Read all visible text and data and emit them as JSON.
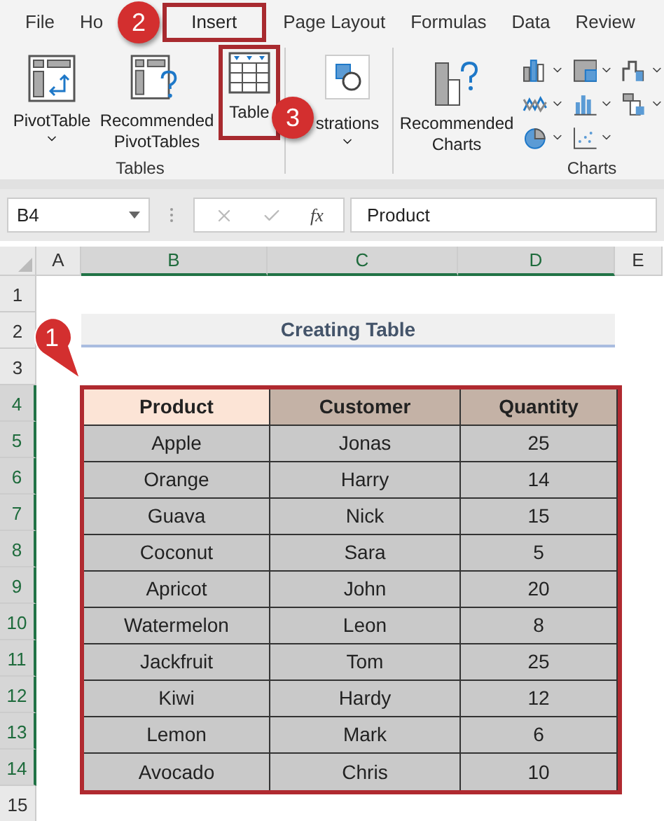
{
  "tabs": [
    {
      "label": "File",
      "selected": false
    },
    {
      "label": "Ho",
      "selected": false
    },
    {
      "label": "Insert",
      "selected": true
    },
    {
      "label": "Page Layout",
      "selected": false
    },
    {
      "label": "Formulas",
      "selected": false
    },
    {
      "label": "Data",
      "selected": false
    },
    {
      "label": "Review",
      "selected": false
    }
  ],
  "ribbon": {
    "groups": [
      {
        "label": "Tables",
        "buttons": [
          {
            "label": "PivotTable",
            "dropdown": true,
            "highlighted": false
          },
          {
            "label": "Recommended PivotTables",
            "dropdown": false,
            "highlighted": false
          },
          {
            "label": "Table",
            "dropdown": false,
            "highlighted": true
          }
        ]
      },
      {
        "buttons": [
          {
            "label": "strations",
            "dropdown": true,
            "highlighted": false
          }
        ]
      },
      {
        "label": "Charts",
        "buttons": [
          {
            "label": "Recommended Charts",
            "dropdown": false,
            "highlighted": false
          }
        ]
      }
    ]
  },
  "name_box": "B4",
  "formula_bar": {
    "function_label": "fx",
    "value": "Product"
  },
  "columns": [
    {
      "label": "A",
      "selected": false
    },
    {
      "label": "B",
      "selected": true
    },
    {
      "label": "C",
      "selected": true
    },
    {
      "label": "D",
      "selected": true
    },
    {
      "label": "E",
      "selected": false
    }
  ],
  "rows": [
    {
      "label": "1",
      "selected": false
    },
    {
      "label": "2",
      "selected": false
    },
    {
      "label": "3",
      "selected": false
    },
    {
      "label": "4",
      "selected": true
    },
    {
      "label": "5",
      "selected": true
    },
    {
      "label": "6",
      "selected": true
    },
    {
      "label": "7",
      "selected": true
    },
    {
      "label": "8",
      "selected": true
    },
    {
      "label": "9",
      "selected": true
    },
    {
      "label": "10",
      "selected": true
    },
    {
      "label": "11",
      "selected": true
    },
    {
      "label": "12",
      "selected": true
    },
    {
      "label": "13",
      "selected": true
    },
    {
      "label": "14",
      "selected": true
    },
    {
      "label": "15",
      "selected": false
    }
  ],
  "title": "Creating Table",
  "table": {
    "highlighted": true,
    "columns": [
      {
        "label": "Product",
        "active": true
      },
      {
        "label": "Customer",
        "active": false
      },
      {
        "label": "Quantity",
        "active": false
      }
    ],
    "rows": [
      [
        "Apple",
        "Jonas",
        "25"
      ],
      [
        "Orange",
        "Harry",
        "14"
      ],
      [
        "Guava",
        "Nick",
        "15"
      ],
      [
        "Coconut",
        "Sara",
        "5"
      ],
      [
        "Apricot",
        "John",
        "20"
      ],
      [
        "Watermelon",
        "Leon",
        "8"
      ],
      [
        "Jackfruit",
        "Tom",
        "25"
      ],
      [
        "Kiwi",
        "Hardy",
        "12"
      ],
      [
        "Lemon",
        "Mark",
        "6"
      ],
      [
        "Avocado",
        "Chris",
        "10"
      ]
    ]
  },
  "callouts": [
    {
      "number": "1"
    },
    {
      "number": "2"
    },
    {
      "number": "3"
    }
  ]
}
